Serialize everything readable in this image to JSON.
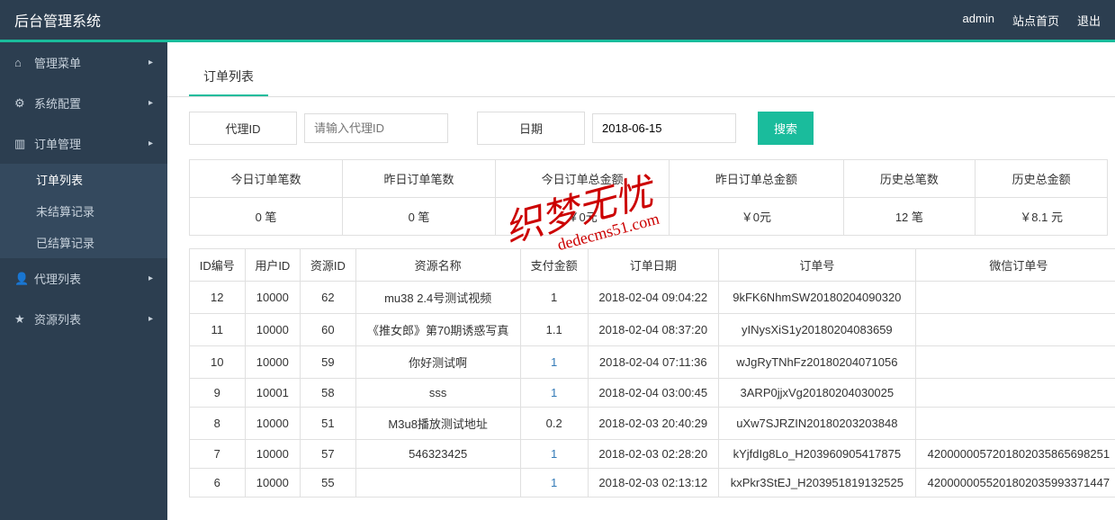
{
  "header": {
    "title": "后台管理系统",
    "user": "admin",
    "home": "站点首页",
    "logout": "退出"
  },
  "sidebar": {
    "items": [
      {
        "icon": "home",
        "label": "管理菜单"
      },
      {
        "icon": "cogs",
        "label": "系统配置"
      },
      {
        "icon": "chart",
        "label": "订单管理",
        "expanded": true,
        "children": [
          {
            "label": "订单列表",
            "active": true
          },
          {
            "label": "未结算记录"
          },
          {
            "label": "已结算记录"
          }
        ]
      },
      {
        "icon": "user",
        "label": "代理列表"
      },
      {
        "icon": "star",
        "label": "资源列表"
      }
    ]
  },
  "tab": {
    "label": "订单列表"
  },
  "filters": {
    "agent_label": "代理ID",
    "agent_placeholder": "请输入代理ID",
    "date_label": "日期",
    "date_value": "2018-06-15",
    "search_btn": "搜索"
  },
  "stats": {
    "headers": [
      "今日订单笔数",
      "昨日订单笔数",
      "今日订单总金额",
      "昨日订单总金额",
      "历史总笔数",
      "历史总金额"
    ],
    "values": [
      "0 笔",
      "0 笔",
      "￥0元",
      "￥0元",
      "12 笔",
      "￥8.1 元"
    ]
  },
  "table": {
    "headers": [
      "ID编号",
      "用户ID",
      "资源ID",
      "资源名称",
      "支付金额",
      "订单日期",
      "订单号",
      "微信订单号"
    ],
    "rows": [
      {
        "id": "12",
        "uid": "10000",
        "rid": "62",
        "name": "mu38 2.4号测试视频",
        "amount": "1",
        "date": "2018-02-04 09:04:22",
        "order": "9kFK6NhmSW20180204090320",
        "wx": ""
      },
      {
        "id": "11",
        "uid": "10000",
        "rid": "60",
        "name": "《推女郎》第70期诱惑写真",
        "amount": "1.1",
        "date": "2018-02-04 08:37:20",
        "order": "yINysXiS1y20180204083659",
        "wx": ""
      },
      {
        "id": "10",
        "uid": "10000",
        "rid": "59",
        "name": "你好测试啊",
        "amount": "1",
        "amount_link": true,
        "date": "2018-02-04 07:11:36",
        "order": "wJgRyTNhFz20180204071056",
        "wx": ""
      },
      {
        "id": "9",
        "uid": "10001",
        "rid": "58",
        "name": "sss",
        "amount": "1",
        "amount_link": true,
        "date": "2018-02-04 03:00:45",
        "order": "3ARP0jjxVg20180204030025",
        "wx": ""
      },
      {
        "id": "8",
        "uid": "10000",
        "rid": "51",
        "name": "M3u8播放测试地址",
        "amount": "0.2",
        "date": "2018-02-03 20:40:29",
        "order": "uXw7SJRZIN20180203203848",
        "wx": ""
      },
      {
        "id": "7",
        "uid": "10000",
        "rid": "57",
        "name": "546323425",
        "amount": "1",
        "amount_link": true,
        "date": "2018-02-03 02:28:20",
        "order": "kYjfdIg8Lo_H203960905417875",
        "wx": "4200000057201802035865698251"
      },
      {
        "id": "6",
        "uid": "10000",
        "rid": "55",
        "name": "",
        "amount": "1",
        "amount_link": true,
        "date": "2018-02-03 02:13:12",
        "order": "kxPkr3StEJ_H203951819132525",
        "wx": "4200000055201802035993371447"
      }
    ]
  },
  "watermark": {
    "big": "织梦无忧",
    "small": "dedecms51.com"
  }
}
